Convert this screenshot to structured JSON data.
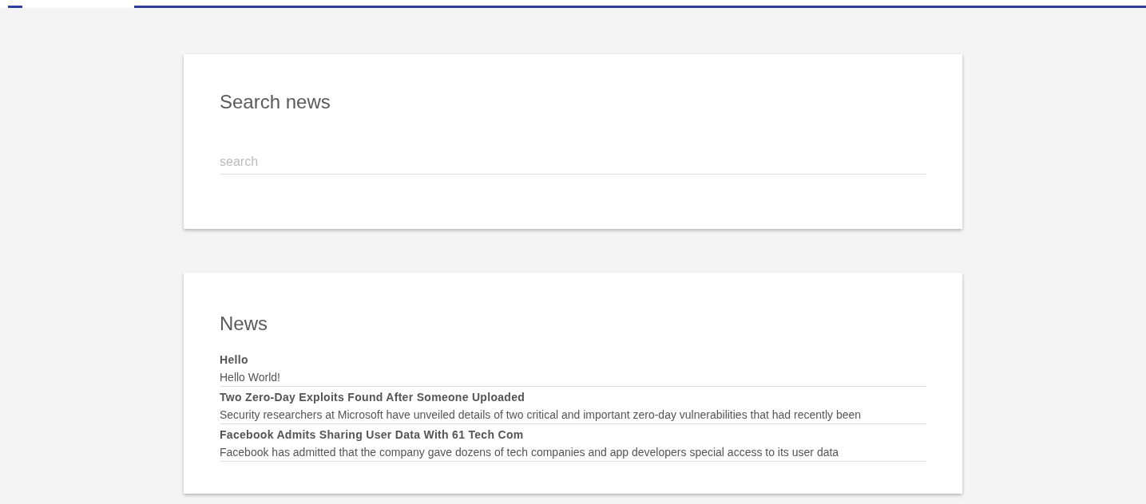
{
  "search_card": {
    "title": "Search news",
    "search": {
      "placeholder": "search"
    }
  },
  "news_card": {
    "title": "News",
    "items": [
      {
        "title": "Hello",
        "body": "Hello World!"
      },
      {
        "title": "Two Zero-Day Exploits Found After Someone Uploaded",
        "body": "Security researchers at Microsoft have unveiled details of two critical and important zero-day vulnerabilities that had recently been"
      },
      {
        "title": "Facebook Admits Sharing User Data With 61 Tech Com",
        "body": "Facebook has admitted that the company gave dozens of tech companies and app developers special access to its user data"
      }
    ]
  }
}
